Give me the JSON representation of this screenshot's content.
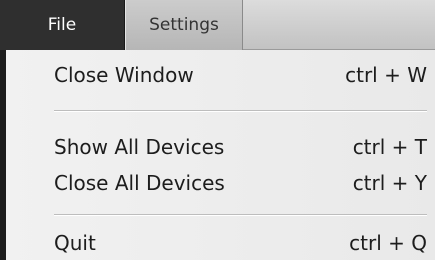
{
  "menubar": {
    "tabs": [
      {
        "label": "File",
        "active": true
      },
      {
        "label": "Settings",
        "active": false
      }
    ]
  },
  "file_menu": {
    "items": [
      {
        "label": "Close Window",
        "shortcut": "ctrl + W"
      },
      {
        "label": "Show All Devices",
        "shortcut": "ctrl + T"
      },
      {
        "label": "Close All Devices",
        "shortcut": "ctrl + Y"
      },
      {
        "label": "Quit",
        "shortcut": "ctrl + Q"
      }
    ]
  },
  "colors": {
    "active_tab_bg": "#2f2f2f",
    "menu_bg": "#eeeeee",
    "text": "#1d1d1d"
  }
}
